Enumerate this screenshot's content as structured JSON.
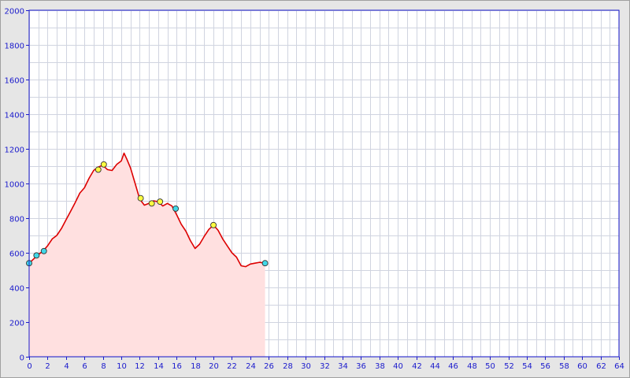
{
  "chart_data": {
    "type": "area",
    "title": "",
    "xlabel": "",
    "ylabel": "",
    "xlim": [
      0,
      64
    ],
    "ylim": [
      0,
      2000
    ],
    "x_ticks": [
      0,
      2,
      4,
      6,
      8,
      10,
      12,
      14,
      16,
      18,
      20,
      22,
      24,
      26,
      28,
      30,
      32,
      34,
      36,
      38,
      40,
      42,
      44,
      46,
      48,
      50,
      52,
      54,
      56,
      58,
      60,
      62,
      64
    ],
    "y_ticks": [
      0,
      200,
      400,
      600,
      800,
      1000,
      1200,
      1400,
      1600,
      1800,
      2000
    ],
    "grid": true,
    "colors": {
      "line": "#dd0000",
      "fill": "#ffe0e0",
      "grid": "#d0d4e0",
      "axis": "#1a1acc",
      "marker_cyan": "#40d8e8",
      "marker_yellow": "#ffff40"
    },
    "series": [
      {
        "x": [
          0,
          0.5,
          1,
          1.5,
          2,
          2.5,
          3,
          3.5,
          4,
          4.5,
          5,
          5.5,
          6,
          6.5,
          7,
          7.5,
          8,
          8.5,
          9,
          9.5,
          10,
          10.3,
          10.6,
          11,
          11.5,
          12,
          12.5,
          13,
          13.5,
          14,
          14.5,
          15,
          15.5,
          16,
          16.5,
          17,
          17.5,
          18,
          18.5,
          19,
          19.5,
          20,
          20.5,
          21,
          21.5,
          22,
          22.5,
          23,
          23.5,
          24,
          24.5,
          25,
          25.6
        ],
        "y": [
          540,
          565,
          590,
          610,
          640,
          680,
          700,
          740,
          790,
          840,
          890,
          945,
          975,
          1030,
          1075,
          1095,
          1105,
          1080,
          1075,
          1110,
          1130,
          1175,
          1140,
          1090,
          1000,
          910,
          875,
          885,
          900,
          895,
          870,
          885,
          870,
          820,
          765,
          725,
          670,
          625,
          650,
          695,
          735,
          760,
          730,
          680,
          640,
          600,
          575,
          525,
          520,
          535,
          540,
          545,
          540
        ]
      }
    ],
    "markers": [
      {
        "x": 0,
        "y": 540,
        "color": "cyan"
      },
      {
        "x": 0.8,
        "y": 585,
        "color": "cyan"
      },
      {
        "x": 1.6,
        "y": 610,
        "color": "cyan"
      },
      {
        "x": 7.5,
        "y": 1080,
        "color": "yellow"
      },
      {
        "x": 8.1,
        "y": 1110,
        "color": "yellow"
      },
      {
        "x": 12.1,
        "y": 915,
        "color": "yellow"
      },
      {
        "x": 13.3,
        "y": 885,
        "color": "yellow"
      },
      {
        "x": 14.2,
        "y": 895,
        "color": "yellow"
      },
      {
        "x": 15.9,
        "y": 855,
        "color": "cyan"
      },
      {
        "x": 20.0,
        "y": 760,
        "color": "yellow"
      },
      {
        "x": 25.6,
        "y": 540,
        "color": "cyan"
      }
    ]
  }
}
